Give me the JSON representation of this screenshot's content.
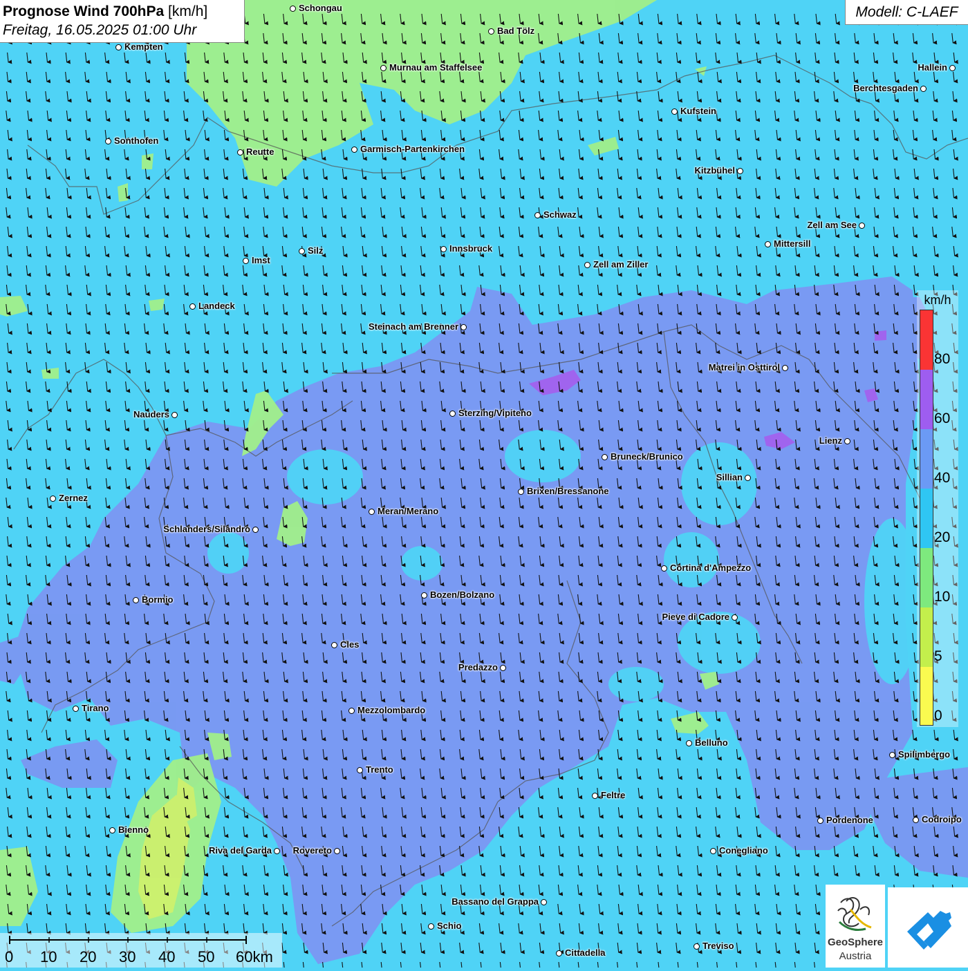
{
  "header": {
    "title_bold": "Prognose Wind 700hPa",
    "title_unit": "[km/h]",
    "date": "Freitag, 16.05.2025 01:00 Uhr"
  },
  "model": "Modell: C-LAEF",
  "legend": {
    "unit": "km/h",
    "labels": [
      "80",
      "60",
      "40",
      "20",
      "10",
      "5",
      "0"
    ],
    "colors": [
      "#fa3434",
      "#9e5df0",
      "#6b9af5",
      "#2fc6f3",
      "#7ee97e",
      "#c3ef4c",
      "#fafa50"
    ]
  },
  "wind": {
    "direction": "north-northwest (arrows pointing south)",
    "colors": {
      "range_20_40": "#4fd3f6",
      "range_40_60": "#7b97f2",
      "range_10_20": "#a1ef8a",
      "range_5_10": "#cdf06e",
      "range_60_80": "#a064ee"
    }
  },
  "scalebar": {
    "labels": [
      "0",
      "10",
      "20",
      "30",
      "40",
      "50",
      "60km"
    ]
  },
  "logos": {
    "geosphere": "GeoSphere",
    "geosphere_sub": "Austria",
    "geosphere_icon": "geosphere-logo-icon",
    "app_icon": "warning-app-logo-icon"
  },
  "cities": [
    {
      "name": "Schongau"
    },
    {
      "name": "Bad Tölz"
    },
    {
      "name": "Kempten"
    },
    {
      "name": "Murnau am Staffelsee"
    },
    {
      "name": "Hallein"
    },
    {
      "name": "Berchtesgaden"
    },
    {
      "name": "Kufstein"
    },
    {
      "name": "Sonthofen"
    },
    {
      "name": "Reutte"
    },
    {
      "name": "Garmisch-Partenkirchen"
    },
    {
      "name": "Kitzbühel"
    },
    {
      "name": "Schwaz"
    },
    {
      "name": "Zell am See"
    },
    {
      "name": "Mittersill"
    },
    {
      "name": "Imst"
    },
    {
      "name": "Silz"
    },
    {
      "name": "Innsbruck"
    },
    {
      "name": "Zell am Ziller"
    },
    {
      "name": "Landeck"
    },
    {
      "name": "Steinach am Brenner"
    },
    {
      "name": "Matrei in Osttirol"
    },
    {
      "name": "Nauders"
    },
    {
      "name": "Sterzing/Vipiteno"
    },
    {
      "name": "Lienz"
    },
    {
      "name": "Bruneck/Brunico"
    },
    {
      "name": "Sillian"
    },
    {
      "name": "Brixen/Bressanone"
    },
    {
      "name": "Zernez"
    },
    {
      "name": "Meran/Merano"
    },
    {
      "name": "Schlanders/Silandro"
    },
    {
      "name": "Cortina d'Ampezzo"
    },
    {
      "name": "Bozen/Bolzano"
    },
    {
      "name": "Bormio"
    },
    {
      "name": "Pieve di Cadore"
    },
    {
      "name": "Cles"
    },
    {
      "name": "Predazzo"
    },
    {
      "name": "Tirano"
    },
    {
      "name": "Mezzolombardo"
    },
    {
      "name": "Belluno"
    },
    {
      "name": "Spilimbergo"
    },
    {
      "name": "Trento"
    },
    {
      "name": "Feltre"
    },
    {
      "name": "Bienno"
    },
    {
      "name": "Pordenone"
    },
    {
      "name": "Codroipo"
    },
    {
      "name": "Riva del Garda"
    },
    {
      "name": "Rovereto"
    },
    {
      "name": "Conegliano"
    },
    {
      "name": "Bassano del Grappa"
    },
    {
      "name": "Schio"
    },
    {
      "name": "Treviso"
    },
    {
      "name": "Cittadella"
    }
  ]
}
